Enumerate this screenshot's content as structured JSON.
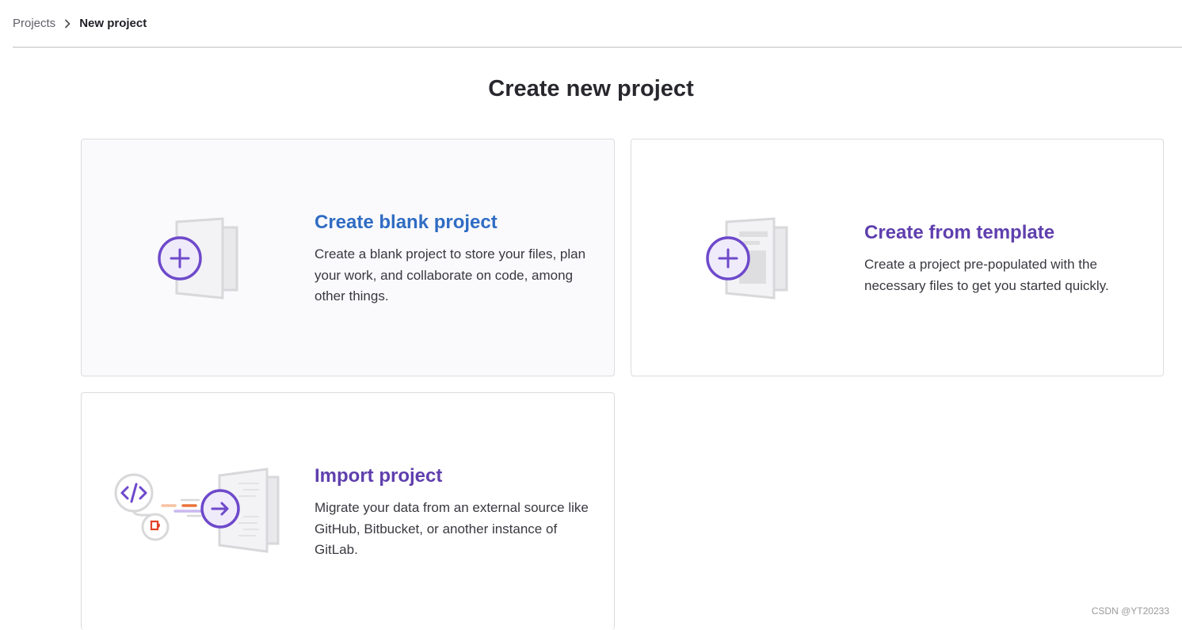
{
  "breadcrumb": {
    "parent": "Projects",
    "separator_icon": "chevron-right-icon",
    "current": "New project"
  },
  "page": {
    "title": "Create new project"
  },
  "cards": {
    "blank": {
      "title": "Create blank project",
      "title_color": "#2f6cc3",
      "description": "Create a blank project to store your files, plan your work, and collaborate on code, among other things.",
      "icon": "blank-project-illustration"
    },
    "template": {
      "title": "Create from template",
      "title_color": "#5f3fae",
      "description": "Create a project pre-populated with the necessary files to get you started quickly.",
      "icon": "template-project-illustration"
    },
    "import": {
      "title": "Import project",
      "title_color": "#5f3fae",
      "description": "Migrate your data from an external source like GitHub, Bitbucket, or another instance of GitLab.",
      "icon": "import-project-illustration"
    }
  },
  "colors": {
    "accent_purple": "#6e49cb",
    "hover_bg": "#fafafc",
    "border": "#dcdcde"
  },
  "watermark": "CSDN @YT20233"
}
